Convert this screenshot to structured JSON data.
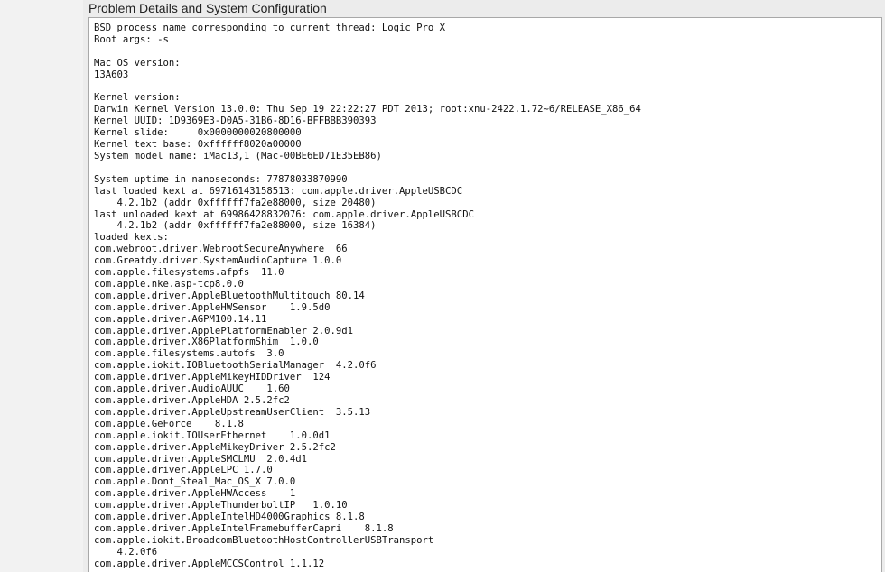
{
  "section": {
    "title": "Problem Details and System Configuration"
  },
  "report": {
    "lines": [
      "BSD process name corresponding to current thread: Logic Pro X",
      "Boot args: -s",
      "",
      "Mac OS version:",
      "13A603",
      "",
      "Kernel version:",
      "Darwin Kernel Version 13.0.0: Thu Sep 19 22:22:27 PDT 2013; root:xnu-2422.1.72~6/RELEASE_X86_64",
      "Kernel UUID: 1D9369E3-D0A5-31B6-8D16-BFFBBB390393",
      "Kernel slide:     0x0000000020800000",
      "Kernel text base: 0xffffff8020a00000",
      "System model name: iMac13,1 (Mac-00BE6ED71E35EB86)",
      "",
      "System uptime in nanoseconds: 77878033870990",
      "last loaded kext at 69716143158513: com.apple.driver.AppleUSBCDC",
      "    4.2.1b2 (addr 0xffffff7fa2e88000, size 20480)",
      "last unloaded kext at 69986428832076: com.apple.driver.AppleUSBCDC",
      "    4.2.1b2 (addr 0xffffff7fa2e88000, size 16384)",
      "loaded kexts:",
      "com.webroot.driver.WebrootSecureAnywhere  66",
      "com.Greatdy.driver.SystemAudioCapture 1.0.0",
      "com.apple.filesystems.afpfs  11.0",
      "com.apple.nke.asp-tcp8.0.0",
      "com.apple.driver.AppleBluetoothMultitouch 80.14",
      "com.apple.driver.AppleHWSensor    1.9.5d0",
      "com.apple.driver.AGPM100.14.11",
      "com.apple.driver.ApplePlatformEnabler 2.0.9d1",
      "com.apple.driver.X86PlatformShim  1.0.0",
      "com.apple.filesystems.autofs  3.0",
      "com.apple.iokit.IOBluetoothSerialManager  4.2.0f6",
      "com.apple.driver.AppleMikeyHIDDriver  124",
      "com.apple.driver.AudioAUUC    1.60",
      "com.apple.driver.AppleHDA 2.5.2fc2",
      "com.apple.driver.AppleUpstreamUserClient  3.5.13",
      "com.apple.GeForce    8.1.8",
      "com.apple.iokit.IOUserEthernet    1.0.0d1",
      "com.apple.driver.AppleMikeyDriver 2.5.2fc2",
      "com.apple.driver.AppleSMCLMU  2.0.4d1",
      "com.apple.driver.AppleLPC 1.7.0",
      "com.apple.Dont_Steal_Mac_OS_X 7.0.0",
      "com.apple.driver.AppleHWAccess    1",
      "com.apple.driver.AppleThunderboltIP   1.0.10",
      "com.apple.driver.AppleIntelHD4000Graphics 8.1.8",
      "com.apple.driver.AppleIntelFramebufferCapri    8.1.8",
      "com.apple.iokit.BroadcomBluetoothHostControllerUSBTransport",
      "    4.2.0f6",
      "com.apple.driver.AppleMCCSControl 1.1.12"
    ]
  }
}
